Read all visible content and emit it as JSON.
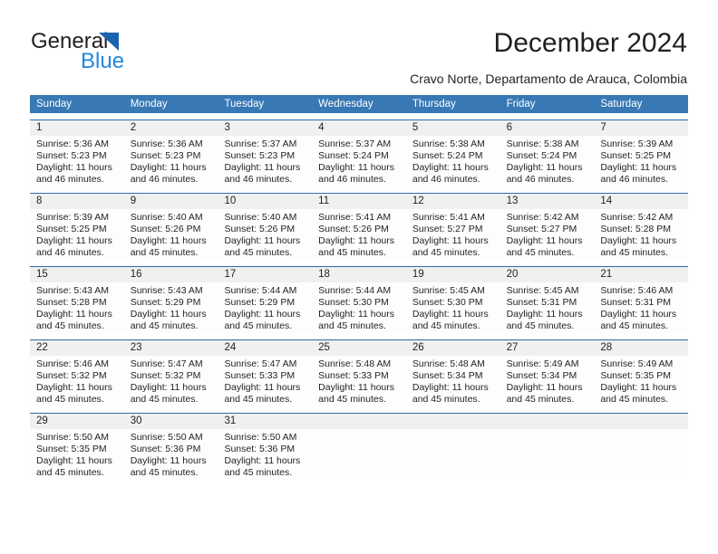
{
  "brand": {
    "name_top": "General",
    "name_bottom": "Blue",
    "accent_color": "#2288dd",
    "triangle_color": "#1b63b0"
  },
  "header": {
    "title": "December 2024",
    "subtitle": "Cravo Norte, Departamento de Arauca, Colombia"
  },
  "calendar": {
    "header_bg": "#3878b4",
    "daynum_bg": "#f0f0f0",
    "weekdays": [
      "Sunday",
      "Monday",
      "Tuesday",
      "Wednesday",
      "Thursday",
      "Friday",
      "Saturday"
    ],
    "weeks": [
      [
        {
          "day": "1",
          "sunrise": "Sunrise: 5:36 AM",
          "sunset": "Sunset: 5:23 PM",
          "daylight1": "Daylight: 11 hours",
          "daylight2": "and 46 minutes."
        },
        {
          "day": "2",
          "sunrise": "Sunrise: 5:36 AM",
          "sunset": "Sunset: 5:23 PM",
          "daylight1": "Daylight: 11 hours",
          "daylight2": "and 46 minutes."
        },
        {
          "day": "3",
          "sunrise": "Sunrise: 5:37 AM",
          "sunset": "Sunset: 5:23 PM",
          "daylight1": "Daylight: 11 hours",
          "daylight2": "and 46 minutes."
        },
        {
          "day": "4",
          "sunrise": "Sunrise: 5:37 AM",
          "sunset": "Sunset: 5:24 PM",
          "daylight1": "Daylight: 11 hours",
          "daylight2": "and 46 minutes."
        },
        {
          "day": "5",
          "sunrise": "Sunrise: 5:38 AM",
          "sunset": "Sunset: 5:24 PM",
          "daylight1": "Daylight: 11 hours",
          "daylight2": "and 46 minutes."
        },
        {
          "day": "6",
          "sunrise": "Sunrise: 5:38 AM",
          "sunset": "Sunset: 5:24 PM",
          "daylight1": "Daylight: 11 hours",
          "daylight2": "and 46 minutes."
        },
        {
          "day": "7",
          "sunrise": "Sunrise: 5:39 AM",
          "sunset": "Sunset: 5:25 PM",
          "daylight1": "Daylight: 11 hours",
          "daylight2": "and 46 minutes."
        }
      ],
      [
        {
          "day": "8",
          "sunrise": "Sunrise: 5:39 AM",
          "sunset": "Sunset: 5:25 PM",
          "daylight1": "Daylight: 11 hours",
          "daylight2": "and 46 minutes."
        },
        {
          "day": "9",
          "sunrise": "Sunrise: 5:40 AM",
          "sunset": "Sunset: 5:26 PM",
          "daylight1": "Daylight: 11 hours",
          "daylight2": "and 45 minutes."
        },
        {
          "day": "10",
          "sunrise": "Sunrise: 5:40 AM",
          "sunset": "Sunset: 5:26 PM",
          "daylight1": "Daylight: 11 hours",
          "daylight2": "and 45 minutes."
        },
        {
          "day": "11",
          "sunrise": "Sunrise: 5:41 AM",
          "sunset": "Sunset: 5:26 PM",
          "daylight1": "Daylight: 11 hours",
          "daylight2": "and 45 minutes."
        },
        {
          "day": "12",
          "sunrise": "Sunrise: 5:41 AM",
          "sunset": "Sunset: 5:27 PM",
          "daylight1": "Daylight: 11 hours",
          "daylight2": "and 45 minutes."
        },
        {
          "day": "13",
          "sunrise": "Sunrise: 5:42 AM",
          "sunset": "Sunset: 5:27 PM",
          "daylight1": "Daylight: 11 hours",
          "daylight2": "and 45 minutes."
        },
        {
          "day": "14",
          "sunrise": "Sunrise: 5:42 AM",
          "sunset": "Sunset: 5:28 PM",
          "daylight1": "Daylight: 11 hours",
          "daylight2": "and 45 minutes."
        }
      ],
      [
        {
          "day": "15",
          "sunrise": "Sunrise: 5:43 AM",
          "sunset": "Sunset: 5:28 PM",
          "daylight1": "Daylight: 11 hours",
          "daylight2": "and 45 minutes."
        },
        {
          "day": "16",
          "sunrise": "Sunrise: 5:43 AM",
          "sunset": "Sunset: 5:29 PM",
          "daylight1": "Daylight: 11 hours",
          "daylight2": "and 45 minutes."
        },
        {
          "day": "17",
          "sunrise": "Sunrise: 5:44 AM",
          "sunset": "Sunset: 5:29 PM",
          "daylight1": "Daylight: 11 hours",
          "daylight2": "and 45 minutes."
        },
        {
          "day": "18",
          "sunrise": "Sunrise: 5:44 AM",
          "sunset": "Sunset: 5:30 PM",
          "daylight1": "Daylight: 11 hours",
          "daylight2": "and 45 minutes."
        },
        {
          "day": "19",
          "sunrise": "Sunrise: 5:45 AM",
          "sunset": "Sunset: 5:30 PM",
          "daylight1": "Daylight: 11 hours",
          "daylight2": "and 45 minutes."
        },
        {
          "day": "20",
          "sunrise": "Sunrise: 5:45 AM",
          "sunset": "Sunset: 5:31 PM",
          "daylight1": "Daylight: 11 hours",
          "daylight2": "and 45 minutes."
        },
        {
          "day": "21",
          "sunrise": "Sunrise: 5:46 AM",
          "sunset": "Sunset: 5:31 PM",
          "daylight1": "Daylight: 11 hours",
          "daylight2": "and 45 minutes."
        }
      ],
      [
        {
          "day": "22",
          "sunrise": "Sunrise: 5:46 AM",
          "sunset": "Sunset: 5:32 PM",
          "daylight1": "Daylight: 11 hours",
          "daylight2": "and 45 minutes."
        },
        {
          "day": "23",
          "sunrise": "Sunrise: 5:47 AM",
          "sunset": "Sunset: 5:32 PM",
          "daylight1": "Daylight: 11 hours",
          "daylight2": "and 45 minutes."
        },
        {
          "day": "24",
          "sunrise": "Sunrise: 5:47 AM",
          "sunset": "Sunset: 5:33 PM",
          "daylight1": "Daylight: 11 hours",
          "daylight2": "and 45 minutes."
        },
        {
          "day": "25",
          "sunrise": "Sunrise: 5:48 AM",
          "sunset": "Sunset: 5:33 PM",
          "daylight1": "Daylight: 11 hours",
          "daylight2": "and 45 minutes."
        },
        {
          "day": "26",
          "sunrise": "Sunrise: 5:48 AM",
          "sunset": "Sunset: 5:34 PM",
          "daylight1": "Daylight: 11 hours",
          "daylight2": "and 45 minutes."
        },
        {
          "day": "27",
          "sunrise": "Sunrise: 5:49 AM",
          "sunset": "Sunset: 5:34 PM",
          "daylight1": "Daylight: 11 hours",
          "daylight2": "and 45 minutes."
        },
        {
          "day": "28",
          "sunrise": "Sunrise: 5:49 AM",
          "sunset": "Sunset: 5:35 PM",
          "daylight1": "Daylight: 11 hours",
          "daylight2": "and 45 minutes."
        }
      ],
      [
        {
          "day": "29",
          "sunrise": "Sunrise: 5:50 AM",
          "sunset": "Sunset: 5:35 PM",
          "daylight1": "Daylight: 11 hours",
          "daylight2": "and 45 minutes."
        },
        {
          "day": "30",
          "sunrise": "Sunrise: 5:50 AM",
          "sunset": "Sunset: 5:36 PM",
          "daylight1": "Daylight: 11 hours",
          "daylight2": "and 45 minutes."
        },
        {
          "day": "31",
          "sunrise": "Sunrise: 5:50 AM",
          "sunset": "Sunset: 5:36 PM",
          "daylight1": "Daylight: 11 hours",
          "daylight2": "and 45 minutes."
        },
        {
          "day": "",
          "sunrise": "",
          "sunset": "",
          "daylight1": "",
          "daylight2": ""
        },
        {
          "day": "",
          "sunrise": "",
          "sunset": "",
          "daylight1": "",
          "daylight2": ""
        },
        {
          "day": "",
          "sunrise": "",
          "sunset": "",
          "daylight1": "",
          "daylight2": ""
        },
        {
          "day": "",
          "sunrise": "",
          "sunset": "",
          "daylight1": "",
          "daylight2": ""
        }
      ]
    ]
  }
}
